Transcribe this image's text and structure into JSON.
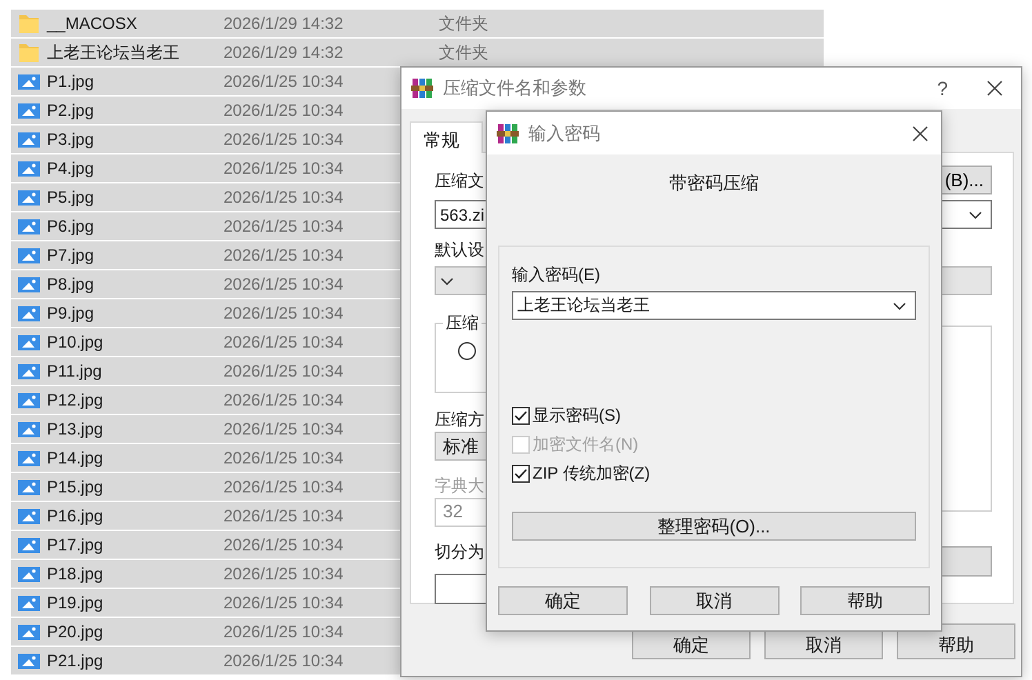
{
  "file_list": {
    "rows": [
      {
        "kind": "folder",
        "name": "__MACOSX",
        "date": "2026/1/29 14:32",
        "type": "文件夹",
        "selected": true
      },
      {
        "kind": "folder",
        "name": "上老王论坛当老王",
        "date": "2026/1/29 14:32",
        "type": "文件夹",
        "selected": true
      },
      {
        "kind": "image",
        "name": "P1.jpg",
        "date": "2026/1/25 10:34",
        "selected": true
      },
      {
        "kind": "image",
        "name": "P2.jpg",
        "date": "2026/1/25 10:34",
        "selected": true
      },
      {
        "kind": "image",
        "name": "P3.jpg",
        "date": "2026/1/25 10:34",
        "selected": true
      },
      {
        "kind": "image",
        "name": "P4.jpg",
        "date": "2026/1/25 10:34",
        "selected": true
      },
      {
        "kind": "image",
        "name": "P5.jpg",
        "date": "2026/1/25 10:34",
        "selected": true
      },
      {
        "kind": "image",
        "name": "P6.jpg",
        "date": "2026/1/25 10:34",
        "selected": true
      },
      {
        "kind": "image",
        "name": "P7.jpg",
        "date": "2026/1/25 10:34",
        "selected": true
      },
      {
        "kind": "image",
        "name": "P8.jpg",
        "date": "2026/1/25 10:34",
        "selected": true
      },
      {
        "kind": "image",
        "name": "P9.jpg",
        "date": "2026/1/25 10:34",
        "selected": true
      },
      {
        "kind": "image",
        "name": "P10.jpg",
        "date": "2026/1/25 10:34",
        "selected": true
      },
      {
        "kind": "image",
        "name": "P11.jpg",
        "date": "2026/1/25 10:34",
        "selected": true
      },
      {
        "kind": "image",
        "name": "P12.jpg",
        "date": "2026/1/25 10:34",
        "selected": true
      },
      {
        "kind": "image",
        "name": "P13.jpg",
        "date": "2026/1/25 10:34",
        "selected": true
      },
      {
        "kind": "image",
        "name": "P14.jpg",
        "date": "2026/1/25 10:34",
        "selected": true
      },
      {
        "kind": "image",
        "name": "P15.jpg",
        "date": "2026/1/25 10:34",
        "selected": true
      },
      {
        "kind": "image",
        "name": "P16.jpg",
        "date": "2026/1/25 10:34",
        "selected": true
      },
      {
        "kind": "image",
        "name": "P17.jpg",
        "date": "2026/1/25 10:34",
        "selected": true
      },
      {
        "kind": "image",
        "name": "P18.jpg",
        "date": "2026/1/25 10:34",
        "selected": true
      },
      {
        "kind": "image",
        "name": "P19.jpg",
        "date": "2026/1/25 10:34",
        "selected": true
      },
      {
        "kind": "image",
        "name": "P20.jpg",
        "date": "2026/1/25 10:34",
        "selected": true
      },
      {
        "kind": "image",
        "name": "P21.jpg",
        "date": "2026/1/25 10:34",
        "selected": true
      }
    ]
  },
  "archive_dialog": {
    "title": "压缩文件名和参数",
    "help": "?",
    "tabs": [
      {
        "label": "常规",
        "selected": true
      }
    ],
    "archive_name_label": "压缩文",
    "browse_button": "(B)...",
    "archive_name_value": "563.zi",
    "profile_label": "默认设",
    "format_group_label": "压缩",
    "format_radio": {
      "selected": false
    },
    "method_label": "压缩方",
    "method_value": "标准",
    "dict_label": "字典大",
    "dict_value": "32",
    "split_label": "切分为",
    "buttons": [
      "确定",
      "取消",
      "帮助"
    ]
  },
  "password_dialog": {
    "title": "输入密码",
    "heading": "带密码压缩",
    "password_label": "输入密码(E)",
    "password_value": "上老王论坛当老王",
    "options": [
      {
        "label": "显示密码(S)",
        "checked": true,
        "disabled": false
      },
      {
        "label": "加密文件名(N)",
        "checked": false,
        "disabled": true
      },
      {
        "label": "ZIP 传统加密(Z)",
        "checked": true,
        "disabled": false
      }
    ],
    "organize_button": "整理密码(O)...",
    "buttons": [
      "确定",
      "取消",
      "帮助"
    ]
  }
}
